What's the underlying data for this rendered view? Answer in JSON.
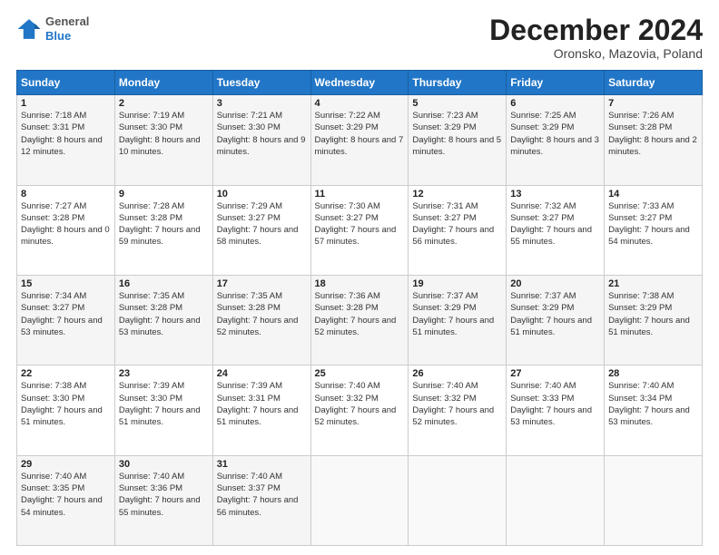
{
  "header": {
    "logo": {
      "line1": "General",
      "line2": "Blue"
    },
    "title": "December 2024",
    "subtitle": "Oronsko, Mazovia, Poland"
  },
  "days_of_week": [
    "Sunday",
    "Monday",
    "Tuesday",
    "Wednesday",
    "Thursday",
    "Friday",
    "Saturday"
  ],
  "weeks": [
    [
      {
        "day": "1",
        "sunrise": "Sunrise: 7:18 AM",
        "sunset": "Sunset: 3:31 PM",
        "daylight": "Daylight: 8 hours and 12 minutes."
      },
      {
        "day": "2",
        "sunrise": "Sunrise: 7:19 AM",
        "sunset": "Sunset: 3:30 PM",
        "daylight": "Daylight: 8 hours and 10 minutes."
      },
      {
        "day": "3",
        "sunrise": "Sunrise: 7:21 AM",
        "sunset": "Sunset: 3:30 PM",
        "daylight": "Daylight: 8 hours and 9 minutes."
      },
      {
        "day": "4",
        "sunrise": "Sunrise: 7:22 AM",
        "sunset": "Sunset: 3:29 PM",
        "daylight": "Daylight: 8 hours and 7 minutes."
      },
      {
        "day": "5",
        "sunrise": "Sunrise: 7:23 AM",
        "sunset": "Sunset: 3:29 PM",
        "daylight": "Daylight: 8 hours and 5 minutes."
      },
      {
        "day": "6",
        "sunrise": "Sunrise: 7:25 AM",
        "sunset": "Sunset: 3:29 PM",
        "daylight": "Daylight: 8 hours and 3 minutes."
      },
      {
        "day": "7",
        "sunrise": "Sunrise: 7:26 AM",
        "sunset": "Sunset: 3:28 PM",
        "daylight": "Daylight: 8 hours and 2 minutes."
      }
    ],
    [
      {
        "day": "8",
        "sunrise": "Sunrise: 7:27 AM",
        "sunset": "Sunset: 3:28 PM",
        "daylight": "Daylight: 8 hours and 0 minutes."
      },
      {
        "day": "9",
        "sunrise": "Sunrise: 7:28 AM",
        "sunset": "Sunset: 3:28 PM",
        "daylight": "Daylight: 7 hours and 59 minutes."
      },
      {
        "day": "10",
        "sunrise": "Sunrise: 7:29 AM",
        "sunset": "Sunset: 3:27 PM",
        "daylight": "Daylight: 7 hours and 58 minutes."
      },
      {
        "day": "11",
        "sunrise": "Sunrise: 7:30 AM",
        "sunset": "Sunset: 3:27 PM",
        "daylight": "Daylight: 7 hours and 57 minutes."
      },
      {
        "day": "12",
        "sunrise": "Sunrise: 7:31 AM",
        "sunset": "Sunset: 3:27 PM",
        "daylight": "Daylight: 7 hours and 56 minutes."
      },
      {
        "day": "13",
        "sunrise": "Sunrise: 7:32 AM",
        "sunset": "Sunset: 3:27 PM",
        "daylight": "Daylight: 7 hours and 55 minutes."
      },
      {
        "day": "14",
        "sunrise": "Sunrise: 7:33 AM",
        "sunset": "Sunset: 3:27 PM",
        "daylight": "Daylight: 7 hours and 54 minutes."
      }
    ],
    [
      {
        "day": "15",
        "sunrise": "Sunrise: 7:34 AM",
        "sunset": "Sunset: 3:27 PM",
        "daylight": "Daylight: 7 hours and 53 minutes."
      },
      {
        "day": "16",
        "sunrise": "Sunrise: 7:35 AM",
        "sunset": "Sunset: 3:28 PM",
        "daylight": "Daylight: 7 hours and 53 minutes."
      },
      {
        "day": "17",
        "sunrise": "Sunrise: 7:35 AM",
        "sunset": "Sunset: 3:28 PM",
        "daylight": "Daylight: 7 hours and 52 minutes."
      },
      {
        "day": "18",
        "sunrise": "Sunrise: 7:36 AM",
        "sunset": "Sunset: 3:28 PM",
        "daylight": "Daylight: 7 hours and 52 minutes."
      },
      {
        "day": "19",
        "sunrise": "Sunrise: 7:37 AM",
        "sunset": "Sunset: 3:29 PM",
        "daylight": "Daylight: 7 hours and 51 minutes."
      },
      {
        "day": "20",
        "sunrise": "Sunrise: 7:37 AM",
        "sunset": "Sunset: 3:29 PM",
        "daylight": "Daylight: 7 hours and 51 minutes."
      },
      {
        "day": "21",
        "sunrise": "Sunrise: 7:38 AM",
        "sunset": "Sunset: 3:29 PM",
        "daylight": "Daylight: 7 hours and 51 minutes."
      }
    ],
    [
      {
        "day": "22",
        "sunrise": "Sunrise: 7:38 AM",
        "sunset": "Sunset: 3:30 PM",
        "daylight": "Daylight: 7 hours and 51 minutes."
      },
      {
        "day": "23",
        "sunrise": "Sunrise: 7:39 AM",
        "sunset": "Sunset: 3:30 PM",
        "daylight": "Daylight: 7 hours and 51 minutes."
      },
      {
        "day": "24",
        "sunrise": "Sunrise: 7:39 AM",
        "sunset": "Sunset: 3:31 PM",
        "daylight": "Daylight: 7 hours and 51 minutes."
      },
      {
        "day": "25",
        "sunrise": "Sunrise: 7:40 AM",
        "sunset": "Sunset: 3:32 PM",
        "daylight": "Daylight: 7 hours and 52 minutes."
      },
      {
        "day": "26",
        "sunrise": "Sunrise: 7:40 AM",
        "sunset": "Sunset: 3:32 PM",
        "daylight": "Daylight: 7 hours and 52 minutes."
      },
      {
        "day": "27",
        "sunrise": "Sunrise: 7:40 AM",
        "sunset": "Sunset: 3:33 PM",
        "daylight": "Daylight: 7 hours and 53 minutes."
      },
      {
        "day": "28",
        "sunrise": "Sunrise: 7:40 AM",
        "sunset": "Sunset: 3:34 PM",
        "daylight": "Daylight: 7 hours and 53 minutes."
      }
    ],
    [
      {
        "day": "29",
        "sunrise": "Sunrise: 7:40 AM",
        "sunset": "Sunset: 3:35 PM",
        "daylight": "Daylight: 7 hours and 54 minutes."
      },
      {
        "day": "30",
        "sunrise": "Sunrise: 7:40 AM",
        "sunset": "Sunset: 3:36 PM",
        "daylight": "Daylight: 7 hours and 55 minutes."
      },
      {
        "day": "31",
        "sunrise": "Sunrise: 7:40 AM",
        "sunset": "Sunset: 3:37 PM",
        "daylight": "Daylight: 7 hours and 56 minutes."
      },
      null,
      null,
      null,
      null
    ]
  ]
}
